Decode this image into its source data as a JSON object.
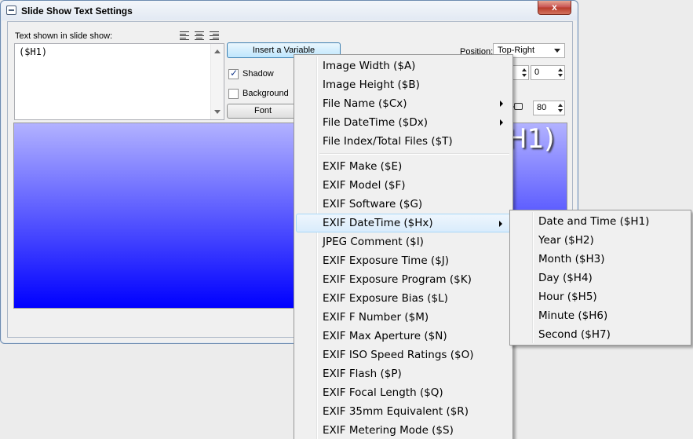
{
  "window": {
    "title": "Slide Show Text Settings",
    "close_label": "x"
  },
  "editor": {
    "label": "Text shown in slide show:",
    "value": "($H1)"
  },
  "controls": {
    "insert_variable_label": "Insert a Variable",
    "shadow_label": "Shadow",
    "shadow_checked": true,
    "background_label": "Background",
    "background_checked": false,
    "font_label": "Font",
    "position_label": "Position:",
    "position_value": "Top-Right",
    "spin_x_value": "",
    "spin_y_value": "0",
    "opacity_value": "80"
  },
  "preview": {
    "text": "H1)"
  },
  "variable_menu": {
    "items": [
      {
        "label": "Image Width ($A)"
      },
      {
        "label": "Image Height ($B)"
      },
      {
        "label": "File Name ($Cx)"
      },
      {
        "label": "File DateTime ($Dx)"
      },
      {
        "label": "File Index/Total Files ($T)"
      },
      {
        "label": "EXIF Make ($E)"
      },
      {
        "label": "EXIF Model ($F)"
      },
      {
        "label": "EXIF Software ($G)"
      },
      {
        "label": "EXIF DateTime ($Hx)"
      },
      {
        "label": "JPEG Comment ($I)"
      },
      {
        "label": "EXIF Exposure Time ($J)"
      },
      {
        "label": "EXIF Exposure Program ($K)"
      },
      {
        "label": "EXIF Exposure Bias ($L)"
      },
      {
        "label": "EXIF F Number ($M)"
      },
      {
        "label": "EXIF Max Aperture ($N)"
      },
      {
        "label": "EXIF ISO Speed Ratings ($O)"
      },
      {
        "label": "EXIF Flash ($P)"
      },
      {
        "label": "EXIF Focal Length ($Q)"
      },
      {
        "label": "EXIF 35mm Equivalent ($R)"
      },
      {
        "label": "EXIF Metering Mode ($S)"
      }
    ]
  },
  "datetime_submenu": {
    "items": [
      {
        "label": "Date and Time ($H1)"
      },
      {
        "label": "Year ($H2)"
      },
      {
        "label": "Month ($H3)"
      },
      {
        "label": "Day ($H4)"
      },
      {
        "label": "Hour ($H5)"
      },
      {
        "label": "Minute ($H6)"
      },
      {
        "label": "Second ($H7)"
      }
    ]
  }
}
